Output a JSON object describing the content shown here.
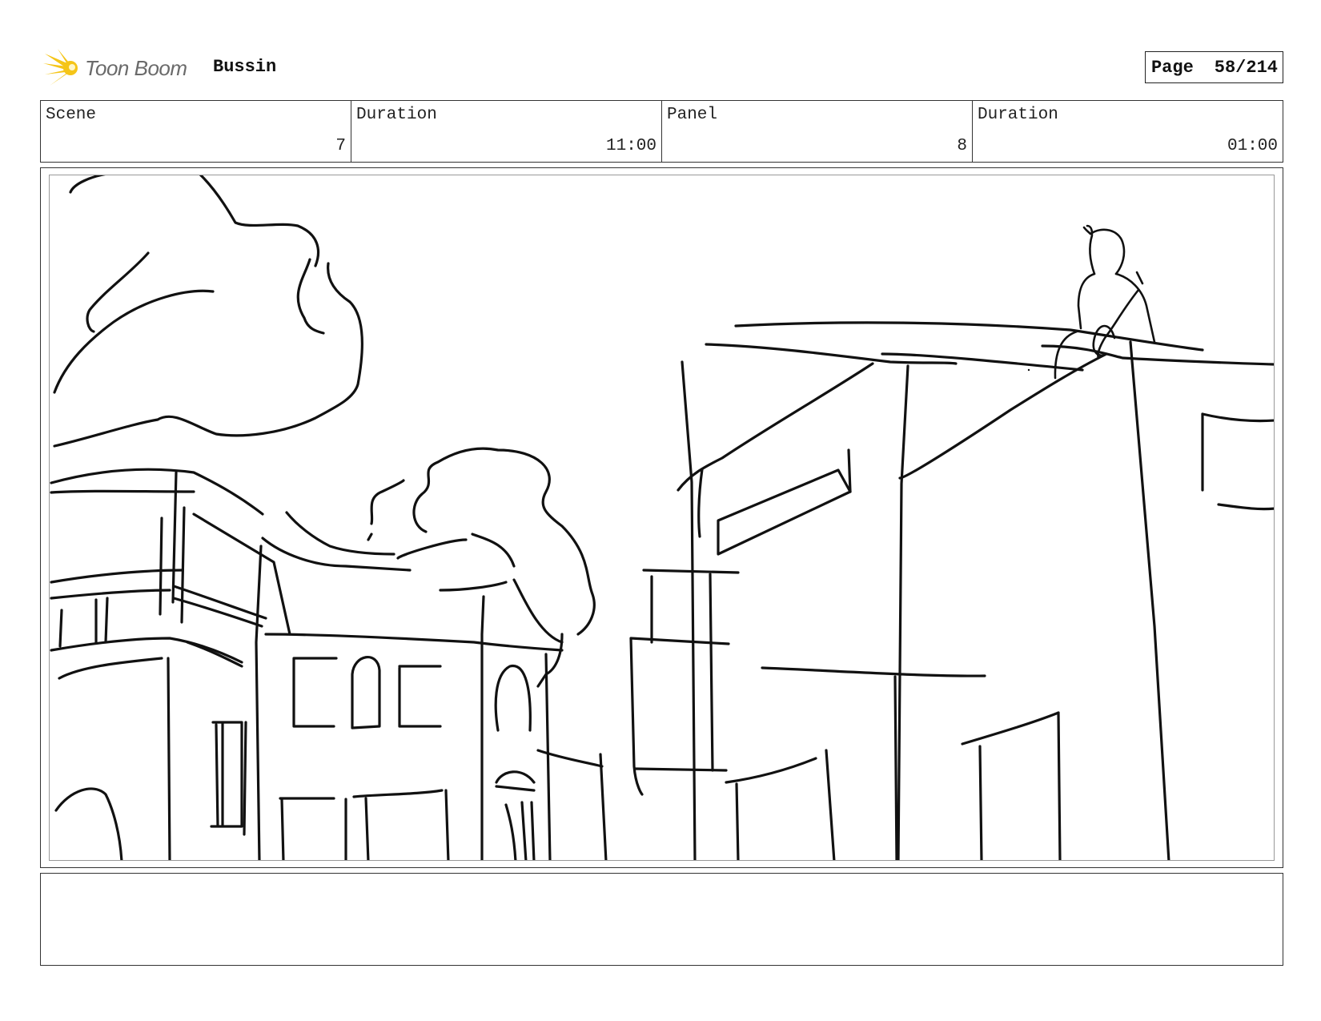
{
  "header": {
    "logo_text": "Toon Boom",
    "project_title": "Bussin",
    "page_label": "Page",
    "page_number": "58/214"
  },
  "info": {
    "scene_label": "Scene",
    "scene_value": "7",
    "scene_duration_label": "Duration",
    "scene_duration_value": "11:00",
    "panel_label": "Panel",
    "panel_value": "8",
    "panel_duration_label": "Duration",
    "panel_duration_value": "01:00"
  },
  "sketch": {
    "subject": "rough storyboard sketch: street with buildings and trees, figure sitting on rooftop"
  },
  "notes": {
    "text": ""
  },
  "colors": {
    "logo_yellow": "#f5c518",
    "logo_text": "#6a6a6a",
    "line": "#111111"
  }
}
